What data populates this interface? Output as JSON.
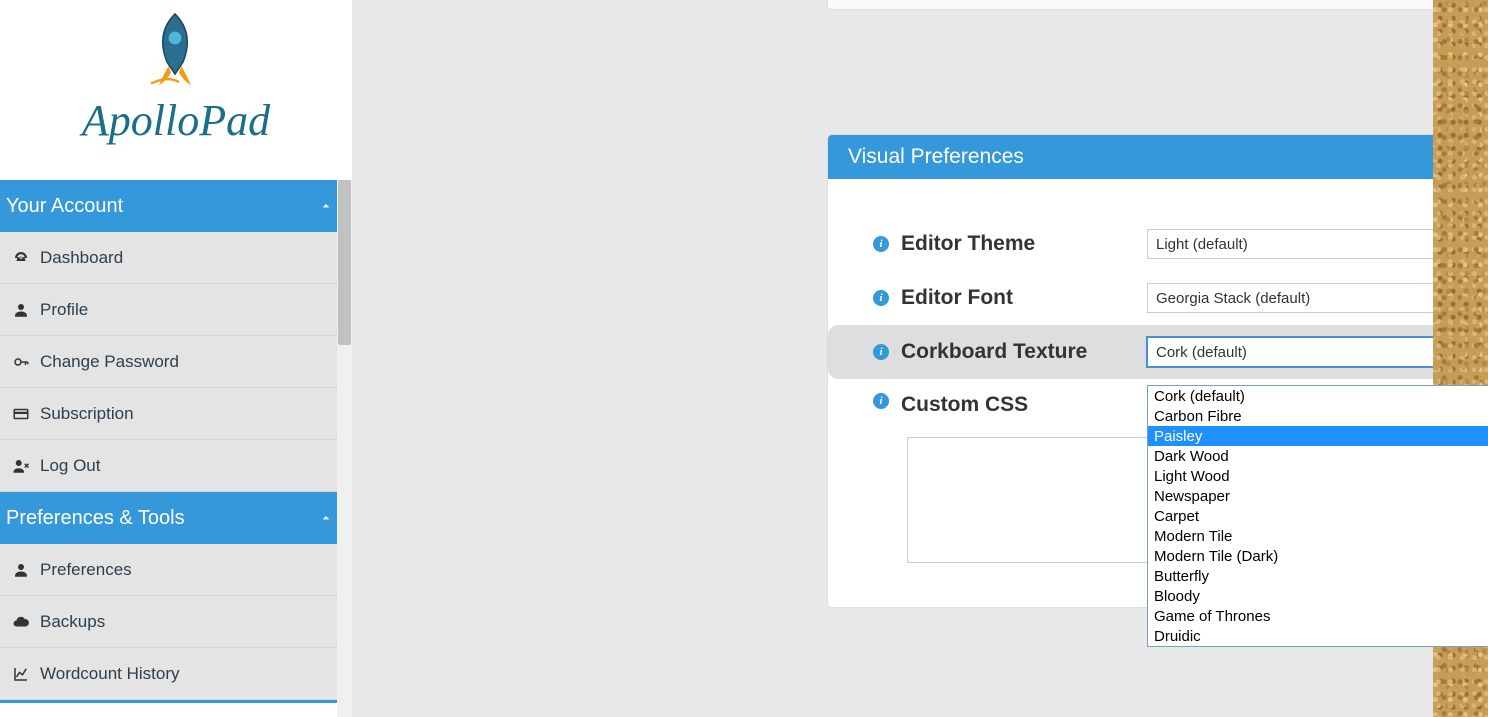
{
  "brand": {
    "name": "ApolloPad"
  },
  "sidebar": {
    "sections": [
      {
        "title": "Your Account",
        "items": [
          {
            "key": "dashboard",
            "label": "Dashboard",
            "icon": "dashboard"
          },
          {
            "key": "profile",
            "label": "Profile",
            "icon": "user"
          },
          {
            "key": "change-password",
            "label": "Change Password",
            "icon": "key"
          },
          {
            "key": "subscription",
            "label": "Subscription",
            "icon": "card"
          },
          {
            "key": "logout",
            "label": "Log Out",
            "icon": "userx"
          }
        ]
      },
      {
        "title": "Preferences & Tools",
        "items": [
          {
            "key": "preferences",
            "label": "Preferences",
            "icon": "user"
          },
          {
            "key": "backups",
            "label": "Backups",
            "icon": "cloud"
          },
          {
            "key": "wordcount",
            "label": "Wordcount History",
            "icon": "chart"
          }
        ]
      }
    ]
  },
  "panel": {
    "title": "Visual Preferences",
    "fields": {
      "theme": {
        "label": "Editor Theme",
        "value": "Light (default)"
      },
      "font": {
        "label": "Editor Font",
        "value": "Georgia Stack (default)"
      },
      "texture": {
        "label": "Corkboard Texture",
        "value": "Cork (default)"
      },
      "css": {
        "label": "Custom CSS",
        "value": ""
      }
    }
  },
  "texture_options": [
    "Cork (default)",
    "Carbon Fibre",
    "Paisley",
    "Dark Wood",
    "Light Wood",
    "Newspaper",
    "Carpet",
    "Modern Tile",
    "Modern Tile (Dark)",
    "Butterfly",
    "Bloody",
    "Game of Thrones",
    "Druidic"
  ],
  "texture_highlighted_index": 2
}
